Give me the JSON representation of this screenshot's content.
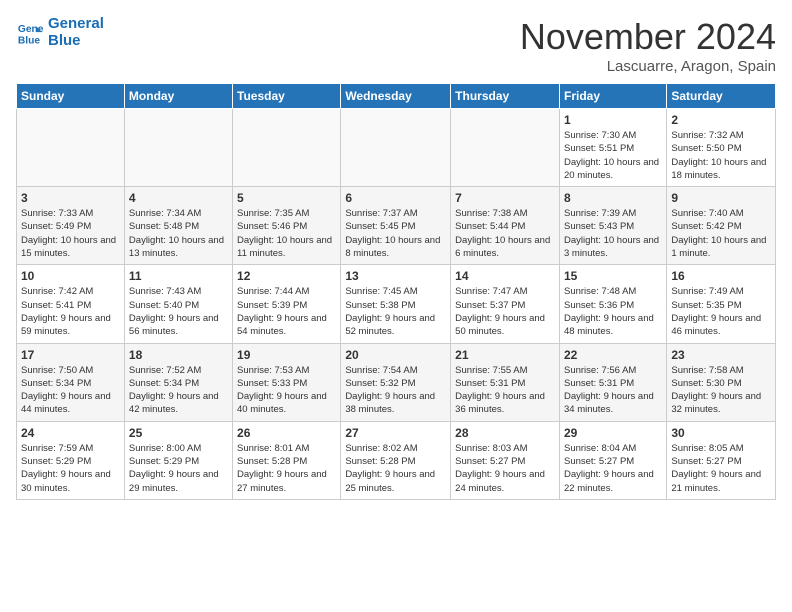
{
  "header": {
    "logo_line1": "General",
    "logo_line2": "Blue",
    "month": "November 2024",
    "location": "Lascuarre, Aragon, Spain"
  },
  "weekdays": [
    "Sunday",
    "Monday",
    "Tuesday",
    "Wednesday",
    "Thursday",
    "Friday",
    "Saturday"
  ],
  "weeks": [
    [
      {
        "day": "",
        "info": ""
      },
      {
        "day": "",
        "info": ""
      },
      {
        "day": "",
        "info": ""
      },
      {
        "day": "",
        "info": ""
      },
      {
        "day": "",
        "info": ""
      },
      {
        "day": "1",
        "info": "Sunrise: 7:30 AM\nSunset: 5:51 PM\nDaylight: 10 hours and 20 minutes."
      },
      {
        "day": "2",
        "info": "Sunrise: 7:32 AM\nSunset: 5:50 PM\nDaylight: 10 hours and 18 minutes."
      }
    ],
    [
      {
        "day": "3",
        "info": "Sunrise: 7:33 AM\nSunset: 5:49 PM\nDaylight: 10 hours and 15 minutes."
      },
      {
        "day": "4",
        "info": "Sunrise: 7:34 AM\nSunset: 5:48 PM\nDaylight: 10 hours and 13 minutes."
      },
      {
        "day": "5",
        "info": "Sunrise: 7:35 AM\nSunset: 5:46 PM\nDaylight: 10 hours and 11 minutes."
      },
      {
        "day": "6",
        "info": "Sunrise: 7:37 AM\nSunset: 5:45 PM\nDaylight: 10 hours and 8 minutes."
      },
      {
        "day": "7",
        "info": "Sunrise: 7:38 AM\nSunset: 5:44 PM\nDaylight: 10 hours and 6 minutes."
      },
      {
        "day": "8",
        "info": "Sunrise: 7:39 AM\nSunset: 5:43 PM\nDaylight: 10 hours and 3 minutes."
      },
      {
        "day": "9",
        "info": "Sunrise: 7:40 AM\nSunset: 5:42 PM\nDaylight: 10 hours and 1 minute."
      }
    ],
    [
      {
        "day": "10",
        "info": "Sunrise: 7:42 AM\nSunset: 5:41 PM\nDaylight: 9 hours and 59 minutes."
      },
      {
        "day": "11",
        "info": "Sunrise: 7:43 AM\nSunset: 5:40 PM\nDaylight: 9 hours and 56 minutes."
      },
      {
        "day": "12",
        "info": "Sunrise: 7:44 AM\nSunset: 5:39 PM\nDaylight: 9 hours and 54 minutes."
      },
      {
        "day": "13",
        "info": "Sunrise: 7:45 AM\nSunset: 5:38 PM\nDaylight: 9 hours and 52 minutes."
      },
      {
        "day": "14",
        "info": "Sunrise: 7:47 AM\nSunset: 5:37 PM\nDaylight: 9 hours and 50 minutes."
      },
      {
        "day": "15",
        "info": "Sunrise: 7:48 AM\nSunset: 5:36 PM\nDaylight: 9 hours and 48 minutes."
      },
      {
        "day": "16",
        "info": "Sunrise: 7:49 AM\nSunset: 5:35 PM\nDaylight: 9 hours and 46 minutes."
      }
    ],
    [
      {
        "day": "17",
        "info": "Sunrise: 7:50 AM\nSunset: 5:34 PM\nDaylight: 9 hours and 44 minutes."
      },
      {
        "day": "18",
        "info": "Sunrise: 7:52 AM\nSunset: 5:34 PM\nDaylight: 9 hours and 42 minutes."
      },
      {
        "day": "19",
        "info": "Sunrise: 7:53 AM\nSunset: 5:33 PM\nDaylight: 9 hours and 40 minutes."
      },
      {
        "day": "20",
        "info": "Sunrise: 7:54 AM\nSunset: 5:32 PM\nDaylight: 9 hours and 38 minutes."
      },
      {
        "day": "21",
        "info": "Sunrise: 7:55 AM\nSunset: 5:31 PM\nDaylight: 9 hours and 36 minutes."
      },
      {
        "day": "22",
        "info": "Sunrise: 7:56 AM\nSunset: 5:31 PM\nDaylight: 9 hours and 34 minutes."
      },
      {
        "day": "23",
        "info": "Sunrise: 7:58 AM\nSunset: 5:30 PM\nDaylight: 9 hours and 32 minutes."
      }
    ],
    [
      {
        "day": "24",
        "info": "Sunrise: 7:59 AM\nSunset: 5:29 PM\nDaylight: 9 hours and 30 minutes."
      },
      {
        "day": "25",
        "info": "Sunrise: 8:00 AM\nSunset: 5:29 PM\nDaylight: 9 hours and 29 minutes."
      },
      {
        "day": "26",
        "info": "Sunrise: 8:01 AM\nSunset: 5:28 PM\nDaylight: 9 hours and 27 minutes."
      },
      {
        "day": "27",
        "info": "Sunrise: 8:02 AM\nSunset: 5:28 PM\nDaylight: 9 hours and 25 minutes."
      },
      {
        "day": "28",
        "info": "Sunrise: 8:03 AM\nSunset: 5:27 PM\nDaylight: 9 hours and 24 minutes."
      },
      {
        "day": "29",
        "info": "Sunrise: 8:04 AM\nSunset: 5:27 PM\nDaylight: 9 hours and 22 minutes."
      },
      {
        "day": "30",
        "info": "Sunrise: 8:05 AM\nSunset: 5:27 PM\nDaylight: 9 hours and 21 minutes."
      }
    ]
  ]
}
